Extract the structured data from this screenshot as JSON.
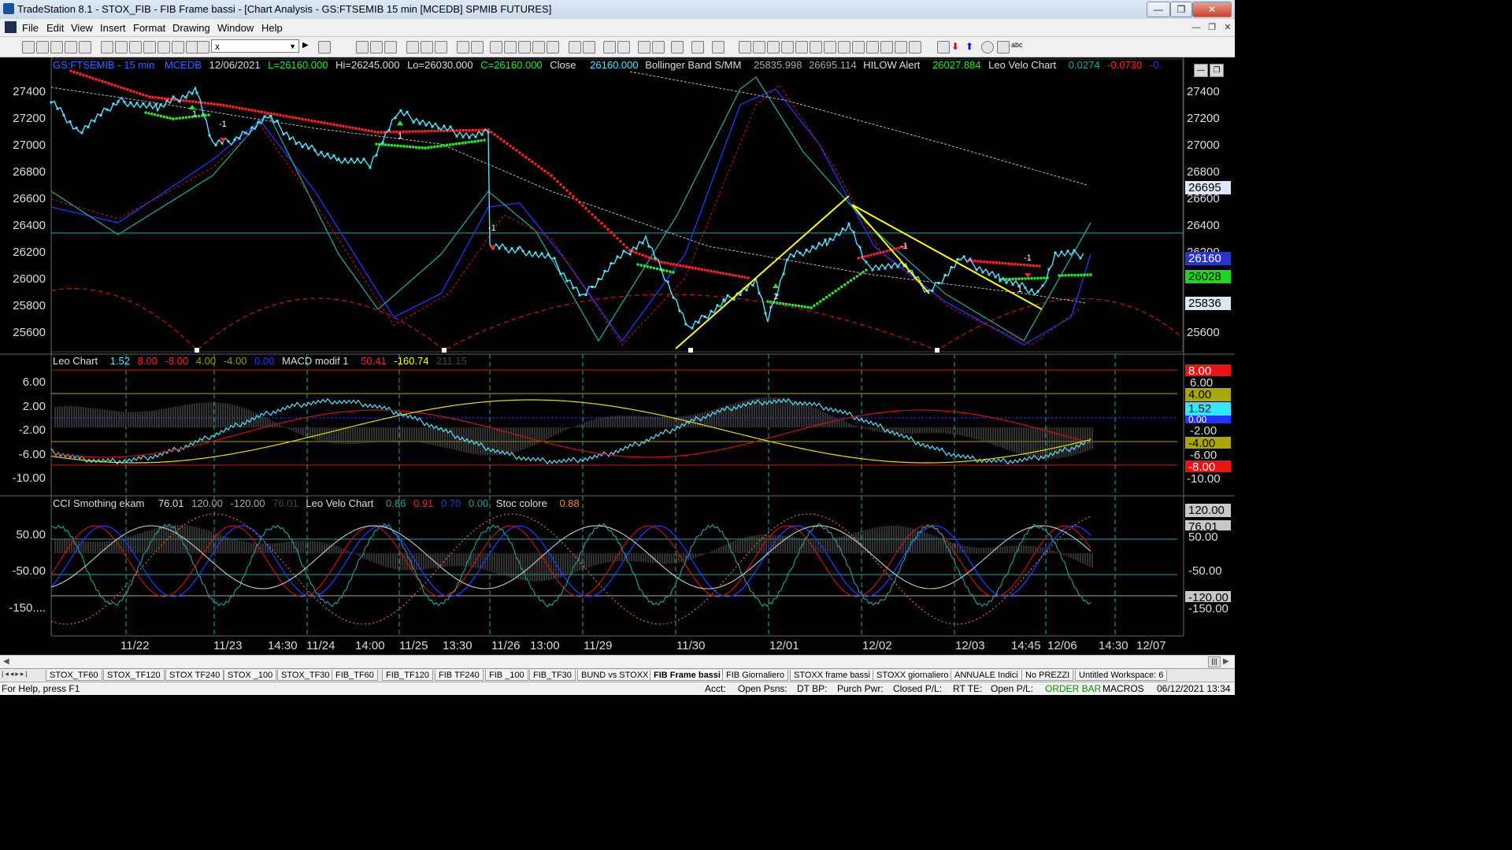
{
  "window": {
    "title": "TradeStation 8.1 - STOX_FIB - FIB Frame bassi - [Chart Analysis - GS:FTSEMIB  15 min  [MCEDB] SPMIB FUTURES]",
    "minimize": "—",
    "maximize": "❐",
    "close": "✕"
  },
  "menu": [
    "File",
    "Edit",
    "View",
    "Insert",
    "Format",
    "Drawing",
    "Window",
    "Help"
  ],
  "toolbar": {
    "combo_value": "x"
  },
  "header": {
    "symbol": "GS:FTSEMIB - 15 min",
    "source": "MCEDB",
    "date": "12/06/2021",
    "last": "L=26160.000",
    "high": "Hi=26245.000",
    "low": "Lo=26030.000",
    "close_c": "C=26160.000",
    "close_label": "Close",
    "close_val": "26160.000",
    "bb_label": "Bollinger Band S/MM",
    "bb1": "25835.998",
    "bb2": "26695.114",
    "hilow_label": "HILOW Alert",
    "hilow_val": "26027.884",
    "leo_label": "Leo Velo Chart",
    "leo1": "0.0274",
    "leo2": "-0.0730",
    "leo3": "-0."
  },
  "panel2_header": {
    "name": "Leo Chart",
    "v1": "1.52",
    "v2": "8.00",
    "v3": "-8.00",
    "v4": "4.00",
    "v5": "-4.00",
    "v6": "0.00",
    "macd_label": "MACD modif 1",
    "m1": "50.41",
    "m2": "-160.74",
    "m3": "211.15"
  },
  "panel3_header": {
    "cci_label": "CCI Smothing ekam",
    "c1": "76.01",
    "c2": "120.00",
    "c3": "-120.00",
    "c4": "76.01",
    "velo_label": "Leo Velo Chart",
    "l1": "0.86",
    "l2": "0.91",
    "l3": "0.70",
    "l4": "0.00",
    "stoc_label": "Stoc colore",
    "s1": "0.88"
  },
  "price_axis": [
    "27400",
    "27200",
    "27000",
    "26800",
    "26600",
    "26400",
    "26200",
    "26000",
    "25800",
    "25600"
  ],
  "price_tags": {
    "bb_upper": "26695",
    "last": "26160",
    "hilow": "26028",
    "bb_lower": "25836"
  },
  "osc_axis": [
    "6.00",
    "2.00",
    "-2.00",
    "-6.00",
    "-10.00"
  ],
  "osc_tags": [
    "8.00",
    "6.00",
    "4.00",
    "1.52",
    "0.00",
    "-2.00",
    "-4.00",
    "-6.00",
    "-8.00",
    "-10.00"
  ],
  "cci_axis": [
    "50.00",
    "-50.00",
    "-150...."
  ],
  "cci_tags": [
    "120.00",
    "76.01",
    "50.00",
    "-50.00",
    "-120.00",
    "-150.00"
  ],
  "x_labels": [
    "11/22",
    "11/23",
    "14:30",
    "11/24",
    "14:00",
    "11/25",
    "13:30",
    "11/26",
    "13:00",
    "11/29",
    "11/30",
    "12/01",
    "12/02",
    "12/03",
    "14:45",
    "12/06",
    "14:30",
    "12/07"
  ],
  "tabs": [
    "STOX_TF60",
    "STOX_TF120",
    "STOX TF240",
    "STOX _100",
    "STOX_TF30",
    "FIB_TF60",
    "FIB_TF120",
    "FIB TF240",
    "FIB _100",
    "FIB_TF30",
    "BUND vs STOXX",
    "FIB Frame bassi",
    "FIB Giornaliero",
    "STOXX frame bassi",
    "STOXX giornaliero",
    "ANNUALE Indici",
    "No PREZZI",
    "Untitled Workspace:  6"
  ],
  "status": {
    "help": "For Help, press F1",
    "acct": "Acct:",
    "open_psns": "Open Psns:",
    "dt_bp": "DT BP:",
    "purch_pwr": "Purch Pwr:",
    "closed_pl": "Closed P/L:",
    "rt_te": "RT TE:",
    "open_pl": "Open P/L:",
    "order_bar": "ORDER BAR",
    "macros": "MACROS",
    "datetime": "06/12/2021 13:34"
  },
  "colors": {
    "price": "#4fe3ff",
    "red_dots": "#ff2020",
    "green_dots": "#22e822",
    "trendline": "#ffff00",
    "bb": "#2233ff",
    "teal": "#1fa39a"
  }
}
